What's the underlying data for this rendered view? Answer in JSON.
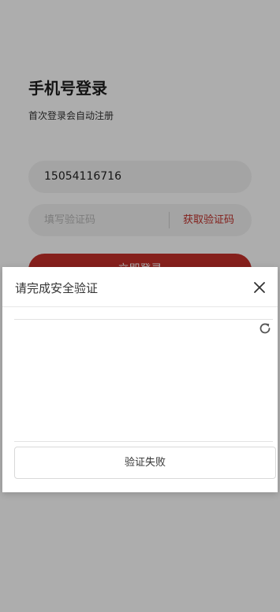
{
  "login": {
    "title": "手机号登录",
    "subtitle": "首次登录会自动注册",
    "phone_value": "15054116716",
    "code_placeholder": "填写验证码",
    "get_code_label": "获取验证码",
    "login_button_label": "立即登录"
  },
  "dialog": {
    "title": "请完成安全验证",
    "close_icon": "close-icon",
    "refresh_icon": "refresh-icon",
    "status_label": "验证失败"
  },
  "colors": {
    "accent": "#c4302a",
    "overlay": "rgba(0,0,0,0.32)"
  }
}
